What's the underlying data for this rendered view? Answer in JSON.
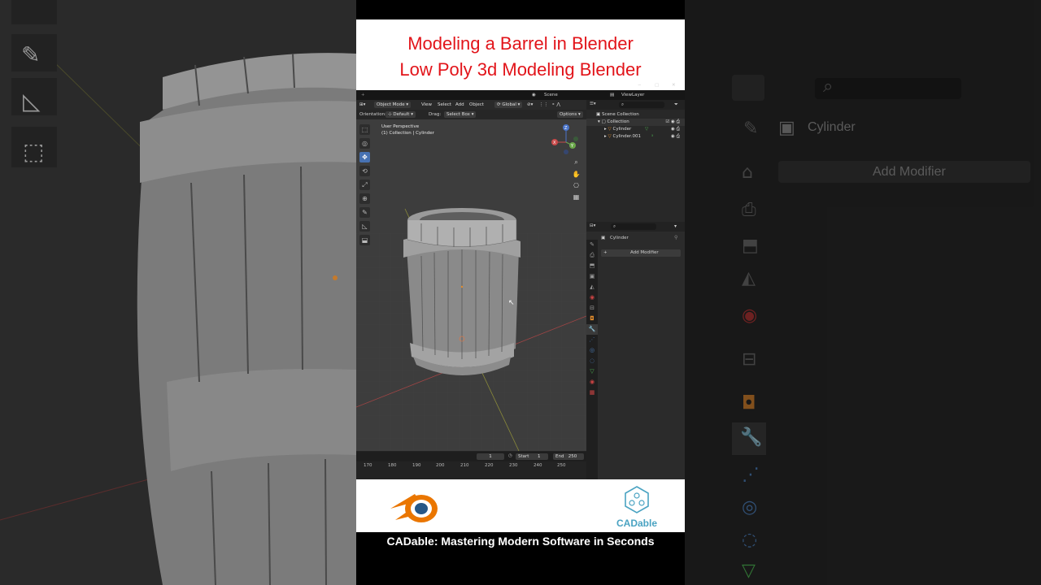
{
  "title": {
    "line1": "Modeling a Barrel in Blender",
    "line2": "Low Poly 3d Modeling Blender"
  },
  "topbar": {
    "scene": "Scene",
    "view_layer": "ViewLayer",
    "win_min": "−",
    "win_max": "▢",
    "win_close": "✕"
  },
  "viewport_header": {
    "mode": "Object Mode",
    "menus": [
      "View",
      "Select",
      "Add",
      "Object"
    ],
    "transform": "Global",
    "orientation_label": "Orientation:",
    "orientation_value": "Default",
    "drag_label": "Drag:",
    "drag_value": "Select Box",
    "options": "Options"
  },
  "viewport": {
    "perspective": "User Perspective",
    "collection_info": "(1) Collection | Cylinder",
    "gizmo": {
      "z": "Z",
      "y": "Y",
      "x": "X"
    }
  },
  "tools": [
    "select-box",
    "cursor",
    "move",
    "rotate",
    "scale",
    "transform",
    "annotate",
    "measure",
    "add-cube"
  ],
  "timeline": {
    "current_frame": "1",
    "start_label": "Start",
    "start_value": "1",
    "end_label": "End",
    "end_value": "250",
    "ticks": [
      "170",
      "180",
      "190",
      "200",
      "210",
      "220",
      "230",
      "240",
      "250"
    ]
  },
  "outliner": {
    "scene_collection": "Scene Collection",
    "collection": "Collection",
    "objects": [
      "Cylinder",
      "Cylinder.001"
    ]
  },
  "properties": {
    "object_name": "Cylinder",
    "add_modifier": "Add Modifier"
  },
  "background_right": {
    "object_name": "Cylinder",
    "add_modifier": "Add Modifier"
  },
  "footer": {
    "brand": "CADable",
    "tagline": "CADable: Mastering Modern Software in Seconds"
  },
  "colors": {
    "title_red": "#e2141a",
    "blender_orange": "#ea7600",
    "blender_blue": "#265787",
    "cadable_teal": "#4aa3c2",
    "active_blue": "#4772b3"
  }
}
